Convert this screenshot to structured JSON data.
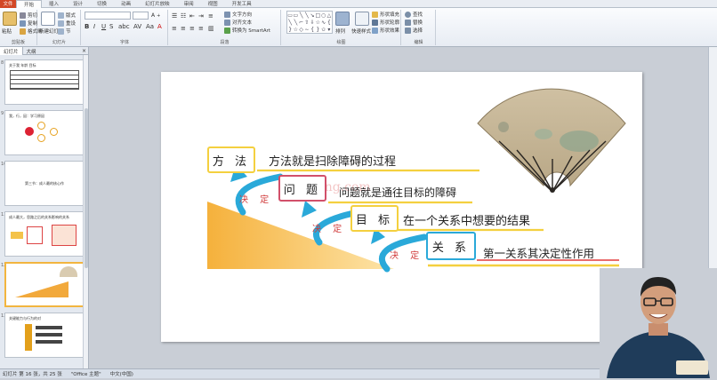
{
  "ribbon_tabs": [
    "文件",
    "开始",
    "插入",
    "设计",
    "切换",
    "动画",
    "幻灯片放映",
    "审阅",
    "视图",
    "开发工具"
  ],
  "active_tab": "开始",
  "ribbon": {
    "clipboard": {
      "label": "剪贴板",
      "paste": "粘贴",
      "cut": "剪切",
      "copy": "复制",
      "format_painter": "格式刷"
    },
    "slides": {
      "label": "幻灯片",
      "new_slide": "新建幻灯片",
      "layout": "版式",
      "reset": "重设",
      "section": "节"
    },
    "font": {
      "label": "字体"
    },
    "paragraph": {
      "label": "段落",
      "text_direction": "文字方向",
      "align_text": "对齐文本",
      "smartart": "转换为 SmartArt"
    },
    "drawing": {
      "label": "绘图",
      "arrange": "排列",
      "quick_styles": "快速样式",
      "fill": "形状填充",
      "outline": "形状轮廓",
      "effects": "形状效果"
    },
    "editing": {
      "label": "编辑",
      "find": "查找",
      "replace": "替换",
      "select": "选择"
    }
  },
  "panel_tabs": {
    "slides": "幻灯片",
    "outline": "大纲"
  },
  "thumbnails": [
    {
      "num": "8",
      "title": "关于我 年龄 目标"
    },
    {
      "num": "9",
      "title": "我，行，因：学习原因"
    },
    {
      "num": "10",
      "title": "第三节：成人最的核心作"
    },
    {
      "num": "11",
      "title": "成人最大，思路之后的关系影响的关系"
    },
    {
      "num": "12",
      "title": ""
    },
    {
      "num": "13",
      "title": "关键能力与行为的对"
    }
  ],
  "slide": {
    "labels": [
      {
        "box": "方 法",
        "text": "方法就是扫除障碍的过程"
      },
      {
        "box": "问 题",
        "text": "问题就是通往目标的障碍"
      },
      {
        "box": "目 标",
        "text": "在一个关系中想要的结果"
      },
      {
        "box": "关 系",
        "text": "第一关系其决定性作用"
      }
    ],
    "decision_label": "决 定",
    "watermark": "itayang.com"
  },
  "status": {
    "slide_info": "幻灯片 第 16 张，共 25 张",
    "theme": "\"Office 主题\"",
    "language": "中文(中国)"
  },
  "colors": {
    "accent_orange": "#f2a93b",
    "box_yellow": "#f4d03f",
    "arrow_blue": "#2aa9d9",
    "box_red": "#d2506a",
    "underline": "#f4d03f"
  }
}
